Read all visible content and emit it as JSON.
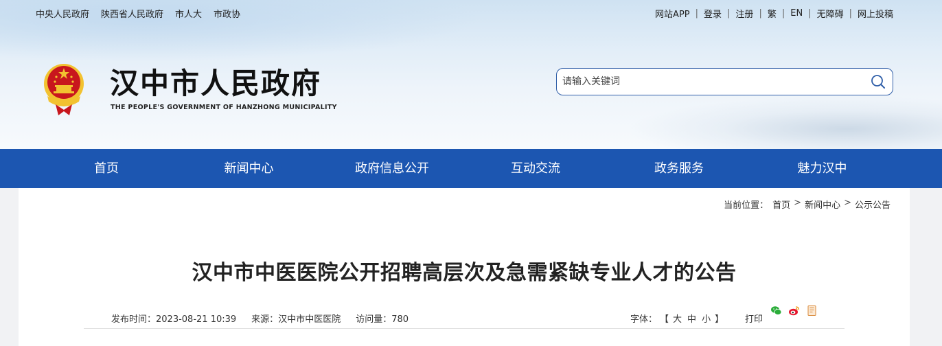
{
  "top_left_links": [
    "中央人民政府",
    "陕西省人民政府",
    "市人大",
    "市政协"
  ],
  "top_right_links": [
    "网站APP",
    "登录",
    "注册",
    "繁",
    "EN",
    "无障碍",
    "网上投稿"
  ],
  "site": {
    "title": "汉中市人民政府",
    "subtitle": "THE PEOPLE'S GOVERNMENT OF HANZHONG MUNICIPALITY"
  },
  "search": {
    "placeholder": "请输入关键词",
    "value": ""
  },
  "nav": [
    "首页",
    "新闻中心",
    "政府信息公开",
    "互动交流",
    "政务服务",
    "魅力汉中"
  ],
  "breadcrumb": {
    "label": "当前位置：",
    "items": [
      "首页",
      "新闻中心",
      "公示公告"
    ]
  },
  "article": {
    "title": "汉中市中医医院公开招聘高层次及急需紧缺专业人才的公告",
    "published_label": "发布时间：",
    "published": "2023-08-21 10:39",
    "source_label": "来源：",
    "source": "汉中市中医医院",
    "views_label": "访问量：",
    "views": "780"
  },
  "font_size": {
    "label": "字体：",
    "open": "【",
    "large": "大",
    "medium": "中",
    "small": "小",
    "close": "】"
  },
  "print_label": "打印",
  "share_icons": [
    "wechat-icon",
    "weibo-icon",
    "copy-icon"
  ],
  "colors": {
    "nav_bg": "#1c56b1",
    "accent": "#2f5ea8",
    "emblem_red": "#c8161d",
    "emblem_gold": "#f2c230"
  }
}
